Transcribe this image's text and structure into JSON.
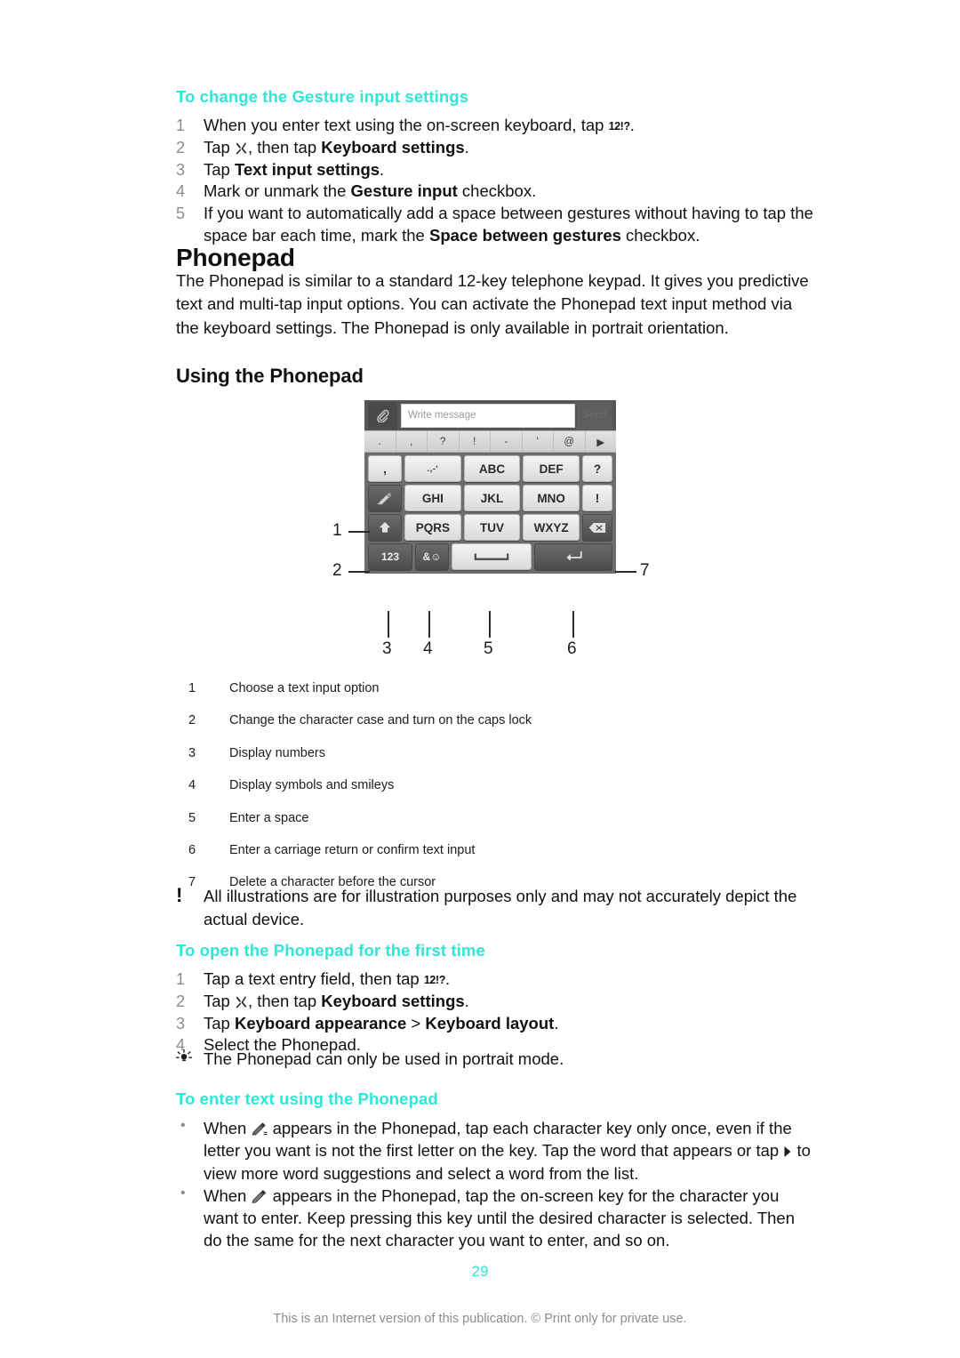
{
  "section_gesture": {
    "heading": "To change the Gesture input settings",
    "steps": [
      {
        "pre": "When you enter text using the on-screen keyboard, tap ",
        "icon": "12!?",
        "post": "."
      },
      {
        "pre": "Tap ",
        "icon": "wrench-icon",
        "mid": ", then tap ",
        "bold": "Keyboard settings",
        "post": "."
      },
      {
        "pre": "Tap ",
        "bold": "Text input settings",
        "post": "."
      },
      {
        "pre": "Mark or unmark the ",
        "bold": "Gesture input",
        "post": " checkbox."
      },
      {
        "pre": "If you want to automatically add a space between gestures without having to tap the space bar each time, mark the ",
        "bold": "Space between gestures",
        "post": " checkbox."
      }
    ]
  },
  "section_phonepad": {
    "title": "Phonepad",
    "paragraph": "The Phonepad is similar to a standard 12-key telephone keypad. It gives you predictive text and multi-tap input options. You can activate the Phonepad text input method via the keyboard settings. The Phonepad is only available in portrait orientation."
  },
  "section_using": {
    "title": "Using the Phonepad"
  },
  "keyboard": {
    "attach_icon": "paperclip-icon",
    "input_placeholder": "Write message",
    "send_label": "Send",
    "symbol_row": [
      ".",
      ",",
      "?",
      "!",
      "-",
      "'",
      "@",
      "▶"
    ],
    "rows": [
      [
        {
          "label": ",",
          "style": "light",
          "size": "narrow"
        },
        {
          "label": ".,-'",
          "style": "light",
          "size": "wide"
        },
        {
          "label": "ABC",
          "style": "light",
          "size": "wide"
        },
        {
          "label": "DEF",
          "style": "light",
          "size": "wide"
        },
        {
          "label": "?",
          "style": "light",
          "size": "small"
        }
      ],
      [
        {
          "label": "pen-icon",
          "style": "dark",
          "size": "narrow"
        },
        {
          "label": "GHI",
          "style": "light",
          "size": "wide"
        },
        {
          "label": "JKL",
          "style": "light",
          "size": "wide"
        },
        {
          "label": "MNO",
          "style": "light",
          "size": "wide"
        },
        {
          "label": "!",
          "style": "light",
          "size": "small"
        }
      ],
      [
        {
          "label": "shift-icon",
          "style": "dark",
          "size": "narrow"
        },
        {
          "label": "PQRS",
          "style": "light",
          "size": "wide"
        },
        {
          "label": "TUV",
          "style": "light",
          "size": "wide"
        },
        {
          "label": "WXYZ",
          "style": "light",
          "size": "wide"
        },
        {
          "label": "backspace-icon",
          "style": "dark",
          "size": "small"
        }
      ],
      [
        {
          "label": "123",
          "style": "dark",
          "size": "k123"
        },
        {
          "label": "&☺",
          "style": "dark",
          "size": "ksym"
        },
        {
          "label": "space-icon",
          "style": "light",
          "size": "kspace"
        },
        {
          "label": "enter-icon",
          "style": "dark",
          "size": "kenter"
        }
      ]
    ],
    "callouts": {
      "left": [
        "1",
        "2"
      ],
      "right": [
        "7"
      ],
      "bottom": [
        "3",
        "4",
        "5",
        "6"
      ]
    }
  },
  "legend": {
    "items": [
      {
        "num": "1",
        "text": "Choose a text input option"
      },
      {
        "num": "2",
        "text": "Change the character case and turn on the caps lock"
      },
      {
        "num": "3",
        "text": "Display numbers"
      },
      {
        "num": "4",
        "text": "Display symbols and smileys"
      },
      {
        "num": "5",
        "text": "Enter a space"
      },
      {
        "num": "6",
        "text": "Enter a carriage return or confirm text input"
      },
      {
        "num": "7",
        "text": "Delete a character before the cursor"
      }
    ]
  },
  "note_warning": {
    "icon": "exclamation-icon",
    "text": "All illustrations are for illustration purposes only and may not accurately depict the actual device."
  },
  "section_open_first": {
    "heading": "To open the Phonepad for the first time",
    "steps": [
      {
        "pre": "Tap a text entry field, then tap ",
        "icon": "12!?",
        "post": "."
      },
      {
        "pre": "Tap ",
        "icon": "wrench-icon",
        "mid": ", then tap ",
        "bold": "Keyboard settings",
        "post": "."
      },
      {
        "pre": "Tap ",
        "bold": "Keyboard appearance",
        "mid2": " > ",
        "bold2": "Keyboard layout",
        "post": "."
      },
      {
        "pre": "Select the Phonepad.",
        "post": ""
      }
    ]
  },
  "note_tip": {
    "icon": "lightbulb-icon",
    "text": "The Phonepad can only be used in portrait mode."
  },
  "section_enter_text": {
    "heading": "To enter text using the Phonepad",
    "bullets": [
      {
        "p1": "When ",
        "icon1": "gesture-pen-icon",
        "p2": " appears in the Phonepad, tap each character key only once, even if the letter you want is not the first letter on the key. Tap the word that appears or tap ",
        "icon2": "arrow-right-icon",
        "p3": " to view more word suggestions and select a word from the list."
      },
      {
        "p1": "When ",
        "icon1": "pen-icon",
        "p2": " appears in the Phonepad, tap the on-screen key for the character you want to enter. Keep pressing this key until the desired character is selected. Then do the same for the next character you want to enter, and so on.",
        "p3": ""
      }
    ]
  },
  "footer": {
    "page_number": "29",
    "notice": "This is an Internet version of this publication. © Print only for private use."
  },
  "colors": {
    "accent": "#2fe6d7",
    "text": "#111111",
    "muted": "#8d8d8d"
  }
}
